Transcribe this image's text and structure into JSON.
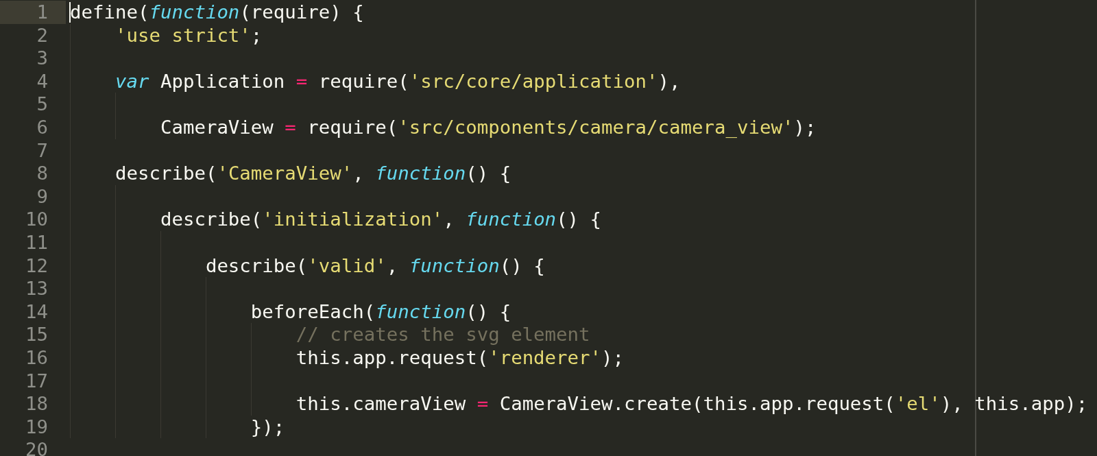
{
  "editor": {
    "lines": [
      {
        "number": "1",
        "selected": true,
        "tokens": [
          {
            "text": "define(",
            "kind": "plain"
          },
          {
            "text": "function",
            "kind": "keyword"
          },
          {
            "text": "(require) {",
            "kind": "plain"
          }
        ]
      },
      {
        "number": "2",
        "selected": false,
        "tokens": [
          {
            "text": "    'use strict'",
            "kind": "string"
          },
          {
            "text": ";",
            "kind": "plain"
          }
        ]
      },
      {
        "number": "3",
        "selected": false
      },
      {
        "number": "4",
        "selected": false,
        "tokens": [
          {
            "text": "    var",
            "kind": "keyword"
          },
          {
            "text": " Application ",
            "kind": "plain"
          },
          {
            "text": "=",
            "kind": "operator"
          },
          {
            "text": " require(",
            "kind": "plain"
          },
          {
            "text": "'src/core/application'",
            "kind": "string"
          },
          {
            "text": "),",
            "kind": "plain"
          }
        ]
      },
      {
        "number": "5",
        "selected": false
      },
      {
        "number": "6",
        "selected": false,
        "tokens": [
          {
            "text": "        CameraView ",
            "kind": "plain"
          },
          {
            "text": "=",
            "kind": "operator"
          },
          {
            "text": " require(",
            "kind": "plain"
          },
          {
            "text": "'src/components/camera/camera_view'",
            "kind": "string"
          },
          {
            "text": ");",
            "kind": "plain"
          }
        ]
      },
      {
        "number": "7",
        "selected": false
      },
      {
        "number": "8",
        "selected": false,
        "tokens": [
          {
            "text": "    describe(",
            "kind": "plain"
          },
          {
            "text": "'CameraView'",
            "kind": "string"
          },
          {
            "text": ", ",
            "kind": "plain"
          },
          {
            "text": "function",
            "kind": "keyword"
          },
          {
            "text": "() {",
            "kind": "plain"
          }
        ]
      },
      {
        "number": "9",
        "selected": false
      },
      {
        "number": "10",
        "selected": false,
        "tokens": [
          {
            "text": "        describe(",
            "kind": "plain"
          },
          {
            "text": "'initialization'",
            "kind": "string"
          },
          {
            "text": ", ",
            "kind": "plain"
          },
          {
            "text": "function",
            "kind": "keyword"
          },
          {
            "text": "() {",
            "kind": "plain"
          }
        ]
      },
      {
        "number": "11",
        "selected": false
      },
      {
        "number": "12",
        "selected": false,
        "tokens": [
          {
            "text": "            describe(",
            "kind": "plain"
          },
          {
            "text": "'valid'",
            "kind": "string"
          },
          {
            "text": ", ",
            "kind": "plain"
          },
          {
            "text": "function",
            "kind": "keyword"
          },
          {
            "text": "() {",
            "kind": "plain"
          }
        ]
      },
      {
        "number": "13",
        "selected": false
      },
      {
        "number": "14",
        "selected": false,
        "tokens": [
          {
            "text": "                beforeEach(",
            "kind": "plain"
          },
          {
            "text": "function",
            "kind": "keyword"
          },
          {
            "text": "() {",
            "kind": "plain"
          }
        ]
      },
      {
        "number": "15",
        "selected": false,
        "tokens": [
          {
            "text": "                    // creates the svg element",
            "kind": "comment"
          }
        ]
      },
      {
        "number": "16",
        "selected": false,
        "tokens": [
          {
            "text": "                    this.app.request(",
            "kind": "plain"
          },
          {
            "text": "'renderer'",
            "kind": "string"
          },
          {
            "text": ");",
            "kind": "plain"
          }
        ]
      },
      {
        "number": "17",
        "selected": false
      },
      {
        "number": "18",
        "selected": false,
        "tokens": [
          {
            "text": "                    this.cameraView ",
            "kind": "plain"
          },
          {
            "text": "=",
            "kind": "operator"
          },
          {
            "text": " CameraView.create(this.app.request(",
            "kind": "plain"
          },
          {
            "text": "'el'",
            "kind": "string"
          },
          {
            "text": "), this.app);",
            "kind": "plain"
          }
        ]
      },
      {
        "number": "19",
        "selected": false,
        "tokens": [
          {
            "text": "                });",
            "kind": "plain"
          }
        ]
      },
      {
        "number": "20",
        "selected": false
      }
    ]
  }
}
